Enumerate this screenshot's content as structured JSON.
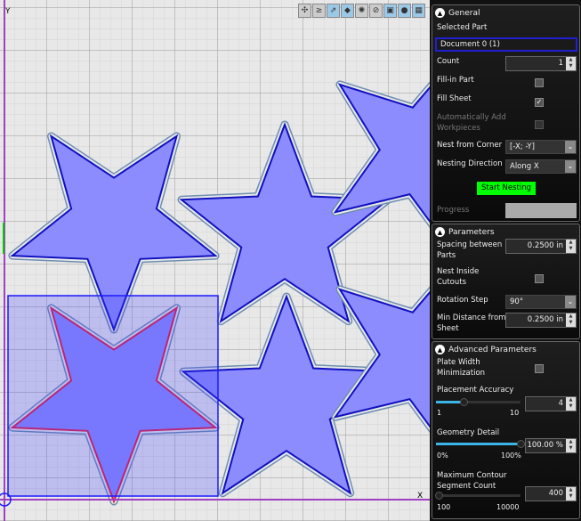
{
  "canvas": {
    "y_axis": "Y",
    "x_axis": "X"
  },
  "toolbar": [
    "part-icon",
    "align-icon",
    "resize-icon",
    "shapes-icon",
    "gear-icon",
    "link-icon",
    "select-icon",
    "point-icon",
    "grid-icon"
  ],
  "general": {
    "title": "General",
    "selected_part_label": "Selected Part",
    "selected_part": "Document 0 (1)",
    "count_label": "Count",
    "count": "1",
    "fill_in_label": "Fill-in Part",
    "fill_in": false,
    "fill_sheet_label": "Fill Sheet",
    "fill_sheet": true,
    "auto_add_label1": "Automatically Add",
    "auto_add_label2": "Workpieces",
    "nest_corner_label": "Nest from Corner",
    "nest_corner": "[-X; -Y]",
    "nest_dir_label": "Nesting Direction",
    "nest_dir": "Along X",
    "start": "Start Nesting",
    "progress_label": "Progress",
    "accent": "#00ff00"
  },
  "parameters": {
    "title": "Parameters",
    "spacing_label1": "Spacing between",
    "spacing_label2": "Parts",
    "spacing": "0.2500 in",
    "nest_inside1": "Nest Inside",
    "nest_inside2": "Cutouts",
    "rotation_label": "Rotation Step",
    "rotation": "90°",
    "min_dist1": "Min Distance from",
    "min_dist2": "Sheet",
    "min_dist": "0.2500 in"
  },
  "advanced": {
    "title": "Advanced Parameters",
    "plate1": "Plate Width",
    "plate2": "Minimization",
    "accuracy_label": "Placement Accuracy",
    "accuracy": "4",
    "accuracy_min": "1",
    "accuracy_max": "10",
    "accuracy_fraction": 0.33,
    "geometry_label": "Geometry Detail",
    "geometry": "100.00 %",
    "geometry_min": "0%",
    "geometry_max": "100%",
    "geometry_fraction": 1.0,
    "segments1": "Maximum Contour",
    "segments2": "Segment Count",
    "segments": "400",
    "segments_min": "100",
    "segments_max": "10000",
    "segments_fraction": 0.03
  }
}
